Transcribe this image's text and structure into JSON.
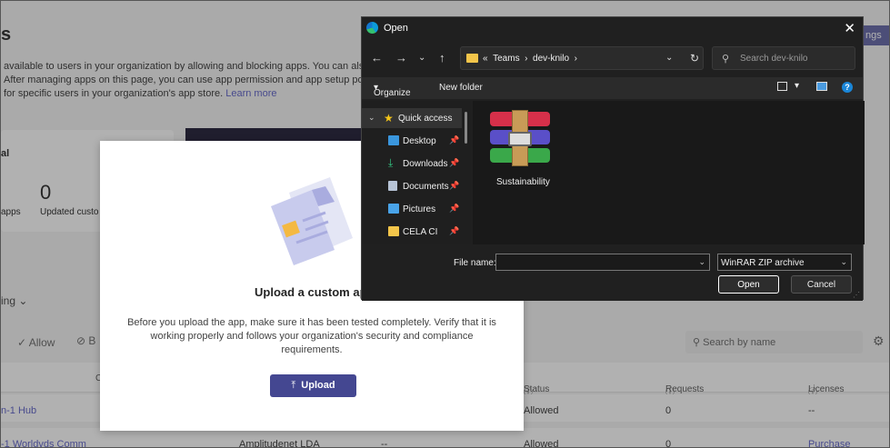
{
  "background": {
    "title": "s",
    "description": [
      "available to users in your organization by allowing and blocking apps. You can als",
      "After managing apps on this page, you can use app permission and app setup pol",
      "for specific users in your organization's app store."
    ],
    "learn_more": "Learn more",
    "top_right_button": "ngs",
    "card": {
      "header": "al",
      "count": "0",
      "label_left": "apps",
      "label_right": "Updated custo"
    },
    "setting_label": "ing",
    "toolbar": {
      "allow": "Allow",
      "block": "B"
    },
    "search_placeholder": "Search by name",
    "table": {
      "headers": {
        "c": "C",
        "status": "Status",
        "requests": "Requests by users",
        "licenses": "Licenses"
      },
      "rows": [
        {
          "app": "n-1 Hub",
          "status": "Allowed",
          "requests": "0",
          "licenses": "--"
        },
        {
          "app": "-1 Worldvds Comm",
          "publisher": "Amplitudenet LDA",
          "certified": "--",
          "status": "Allowed",
          "requests": "0",
          "licenses": "Purchase"
        }
      ]
    }
  },
  "upload_dialog": {
    "title": "Upload a custom ap",
    "description": "Before you upload the app, make sure it has been tested completely. Verify that it is working properly and follows your organization's security and compliance requirements.",
    "button": "Upload"
  },
  "open_dialog": {
    "title": "Open",
    "path": [
      "Teams",
      "dev-knilo"
    ],
    "search_placeholder": "Search dev-knilo",
    "organize": "Organize",
    "new_folder": "New folder",
    "nav_items": [
      {
        "label": "Quick access",
        "icon": "star-icon"
      },
      {
        "label": "Desktop",
        "icon": "desktop-icon"
      },
      {
        "label": "Downloads",
        "icon": "download-icon"
      },
      {
        "label": "Documents",
        "icon": "document-icon"
      },
      {
        "label": "Pictures",
        "icon": "picture-icon"
      },
      {
        "label": "CELA CI",
        "icon": "folder-icon"
      }
    ],
    "file": {
      "name": "Sustainability",
      "icon": "winrar-archive-icon"
    },
    "file_name_label": "File name:",
    "file_name_value": "",
    "file_type": "WinRAR ZIP archive",
    "open_button": "Open",
    "cancel_button": "Cancel"
  },
  "colors": {
    "accent": "#444791",
    "dialog_bg": "#202020",
    "folder": "#f3c54a"
  }
}
